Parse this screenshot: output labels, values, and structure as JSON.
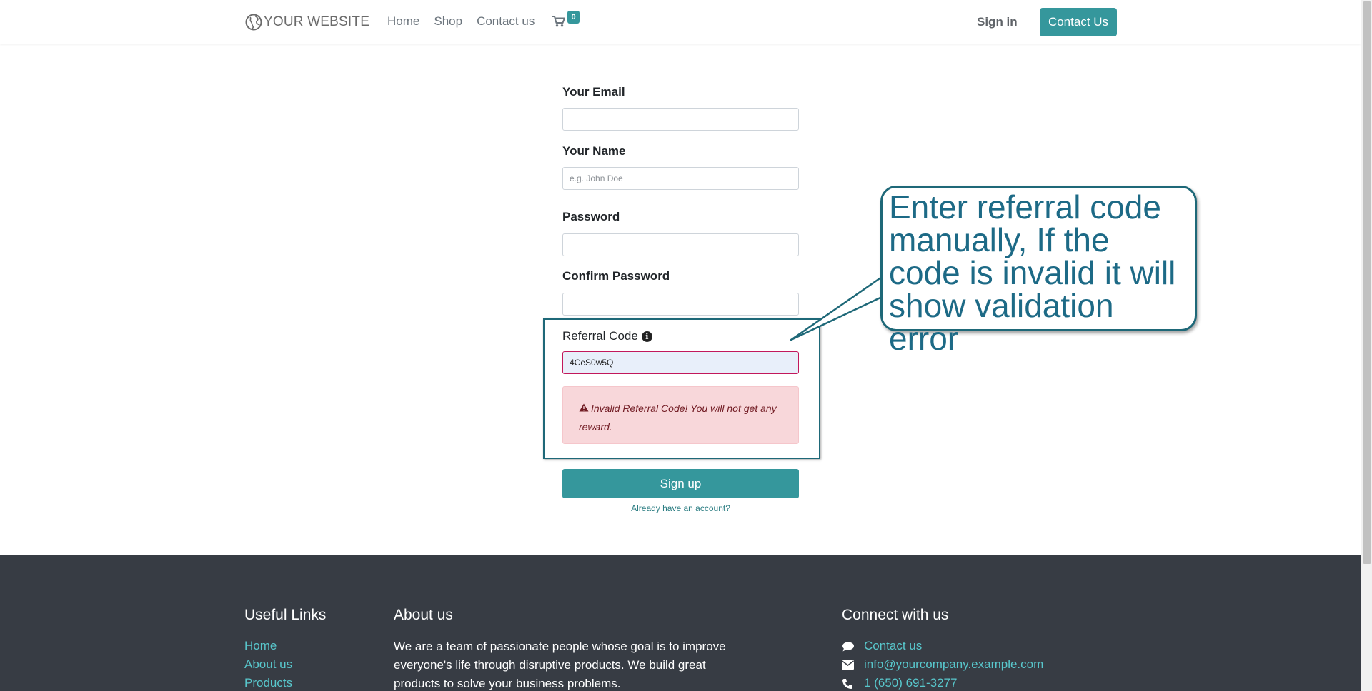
{
  "header": {
    "logo_text": "YOUR WEBSITE",
    "nav": [
      {
        "label": "Home"
      },
      {
        "label": "Shop"
      },
      {
        "label": "Contact us"
      }
    ],
    "cart_count": "0",
    "signin_label": "Sign in",
    "contact_button": "Contact Us"
  },
  "form": {
    "email_label": "Your Email",
    "email_value": "",
    "name_label": "Your Name",
    "name_placeholder": "e.g. John Doe",
    "password_label": "Password",
    "confirm_label": "Confirm Password",
    "referral_label": "Referral Code",
    "referral_value": "4CeS0w5Q",
    "error_message": "Invalid Referral Code! You will not get any reward.",
    "signup_button": "Sign up",
    "already_link": "Already have an account?"
  },
  "callout": {
    "text": "Enter referral code manually, If the code is invalid it will show validation error"
  },
  "footer": {
    "useful_links_title": "Useful Links",
    "useful_links": [
      {
        "label": "Home"
      },
      {
        "label": "About us"
      },
      {
        "label": "Products"
      }
    ],
    "about_title": "About us",
    "about_text": "We are a team of passionate people whose goal is to improve everyone's life through disruptive products. We build great products to solve your business problems.",
    "connect_title": "Connect with us",
    "connect": [
      {
        "icon": "comment-icon",
        "label": "Contact us"
      },
      {
        "icon": "envelope-icon",
        "label": "info@yourcompany.example.com"
      },
      {
        "icon": "phone-icon",
        "label": "1 (650) 691-3277"
      }
    ]
  },
  "colors": {
    "primary": "#35979c",
    "link": "#58c7cc",
    "footer_bg": "#373c44",
    "callout_border": "#1e6878",
    "callout_text": "#1d6a86",
    "error_bg": "#f8d7da",
    "error_text": "#721c24"
  }
}
